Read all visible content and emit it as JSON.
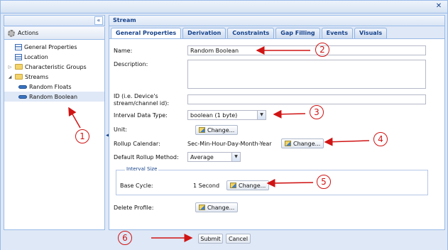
{
  "left_panel": {
    "actions_label": "Actions",
    "collapse_glyph": "«",
    "tree": [
      {
        "label": "General Properties",
        "icon": "grid-icon",
        "indent": 0
      },
      {
        "label": "Location",
        "icon": "grid-icon",
        "indent": 0
      },
      {
        "label": "Characteristic Groups",
        "icon": "folder-icon",
        "indent": 0,
        "toggle": "▷"
      },
      {
        "label": "Streams",
        "icon": "folder-icon",
        "indent": 0,
        "toggle": "◢"
      },
      {
        "label": "Random Floats",
        "icon": "stream-icon",
        "indent": 1
      },
      {
        "label": "Random Boolean",
        "icon": "stream-icon",
        "indent": 1,
        "selected": true
      }
    ]
  },
  "right_panel": {
    "title": "Stream",
    "tabs": [
      "General Properties",
      "Derivation",
      "Constraints",
      "Gap Filling",
      "Events",
      "Visuals"
    ],
    "active_tab": 0
  },
  "form": {
    "name_label": "Name:",
    "name_value": "Random Boolean",
    "description_label": "Description:",
    "description_value": "",
    "id_label_1": "ID (i.e. Device's",
    "id_label_2": "stream/channel id):",
    "id_value": "",
    "interval_label": "Interval Data Type:",
    "interval_value": "boolean (1 byte)",
    "unit_label": "Unit:",
    "rollup_label": "Rollup Calendar:",
    "rollup_value": "Sec-Min-Hour-Day-Month-Year",
    "default_rollup_label": "Default Rollup Method:",
    "default_rollup_value": "Average",
    "interval_size_legend": "Interval Size",
    "base_cycle_label": "Base Cycle:",
    "base_cycle_value": "1 Second",
    "delete_profile_label": "Delete Profile:",
    "change_label": "Change..."
  },
  "footer": {
    "submit_label": "Submit",
    "cancel_label": "Cancel"
  },
  "window": {
    "close_glyph": "✕"
  },
  "annotations": {
    "callouts": [
      "1",
      "2",
      "3",
      "4",
      "5",
      "6"
    ],
    "color": "#d01414"
  }
}
